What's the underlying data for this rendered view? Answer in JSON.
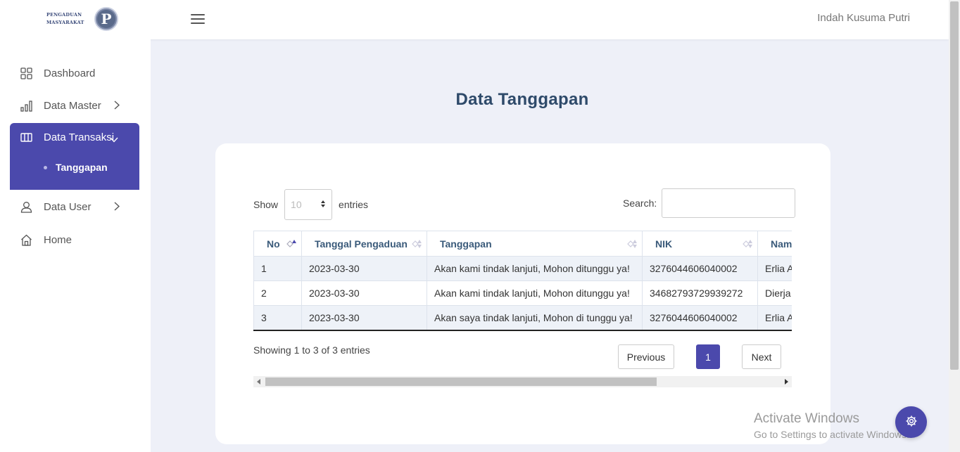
{
  "header": {
    "logo_line1": "PENGADUAN",
    "logo_line2": "MASYARAKAT",
    "logo_letter": "P",
    "user_name": "Indah Kusuma Putri"
  },
  "sidebar": {
    "items": [
      {
        "label": "Dashboard",
        "icon": "grid-icon"
      },
      {
        "label": "Data Master",
        "icon": "bar-chart-icon"
      },
      {
        "label": "Data Transaksi",
        "icon": "columns-icon"
      },
      {
        "label": "Data User",
        "icon": "user-icon"
      },
      {
        "label": "Home",
        "icon": "home-icon"
      }
    ],
    "sub_items": [
      {
        "label": "Tanggapan"
      }
    ],
    "active_color": "#4b49ac"
  },
  "main": {
    "title": "Data Tanggapan",
    "length": {
      "show": "Show",
      "value": "10",
      "entries": "entries"
    },
    "search_label": "Search:",
    "table": {
      "headers": [
        "No",
        "Tanggal Pengaduan",
        "Tanggapan",
        "NIK",
        "Nam"
      ],
      "rows": [
        [
          "1",
          "2023-03-30",
          "Akan kami tindak lanjuti, Mohon ditunggu ya!",
          "3276044606040002",
          "Erlia A"
        ],
        [
          "2",
          "2023-03-30",
          "Akan kami tindak lanjuti, Mohon ditunggu ya!",
          "34682793729939272",
          "Dierja"
        ],
        [
          "3",
          "2023-03-30",
          "Akan saya tindak lanjuti, Mohon di tunggu ya!",
          "3276044606040002",
          "Erlia A"
        ]
      ]
    },
    "info": "Showing 1 to 3 of 3 entries",
    "pagination": {
      "previous": "Previous",
      "page": "1",
      "next": "Next"
    }
  },
  "watermark": {
    "line1": "Activate Windows",
    "line2": "Go to Settings to activate Windows."
  }
}
